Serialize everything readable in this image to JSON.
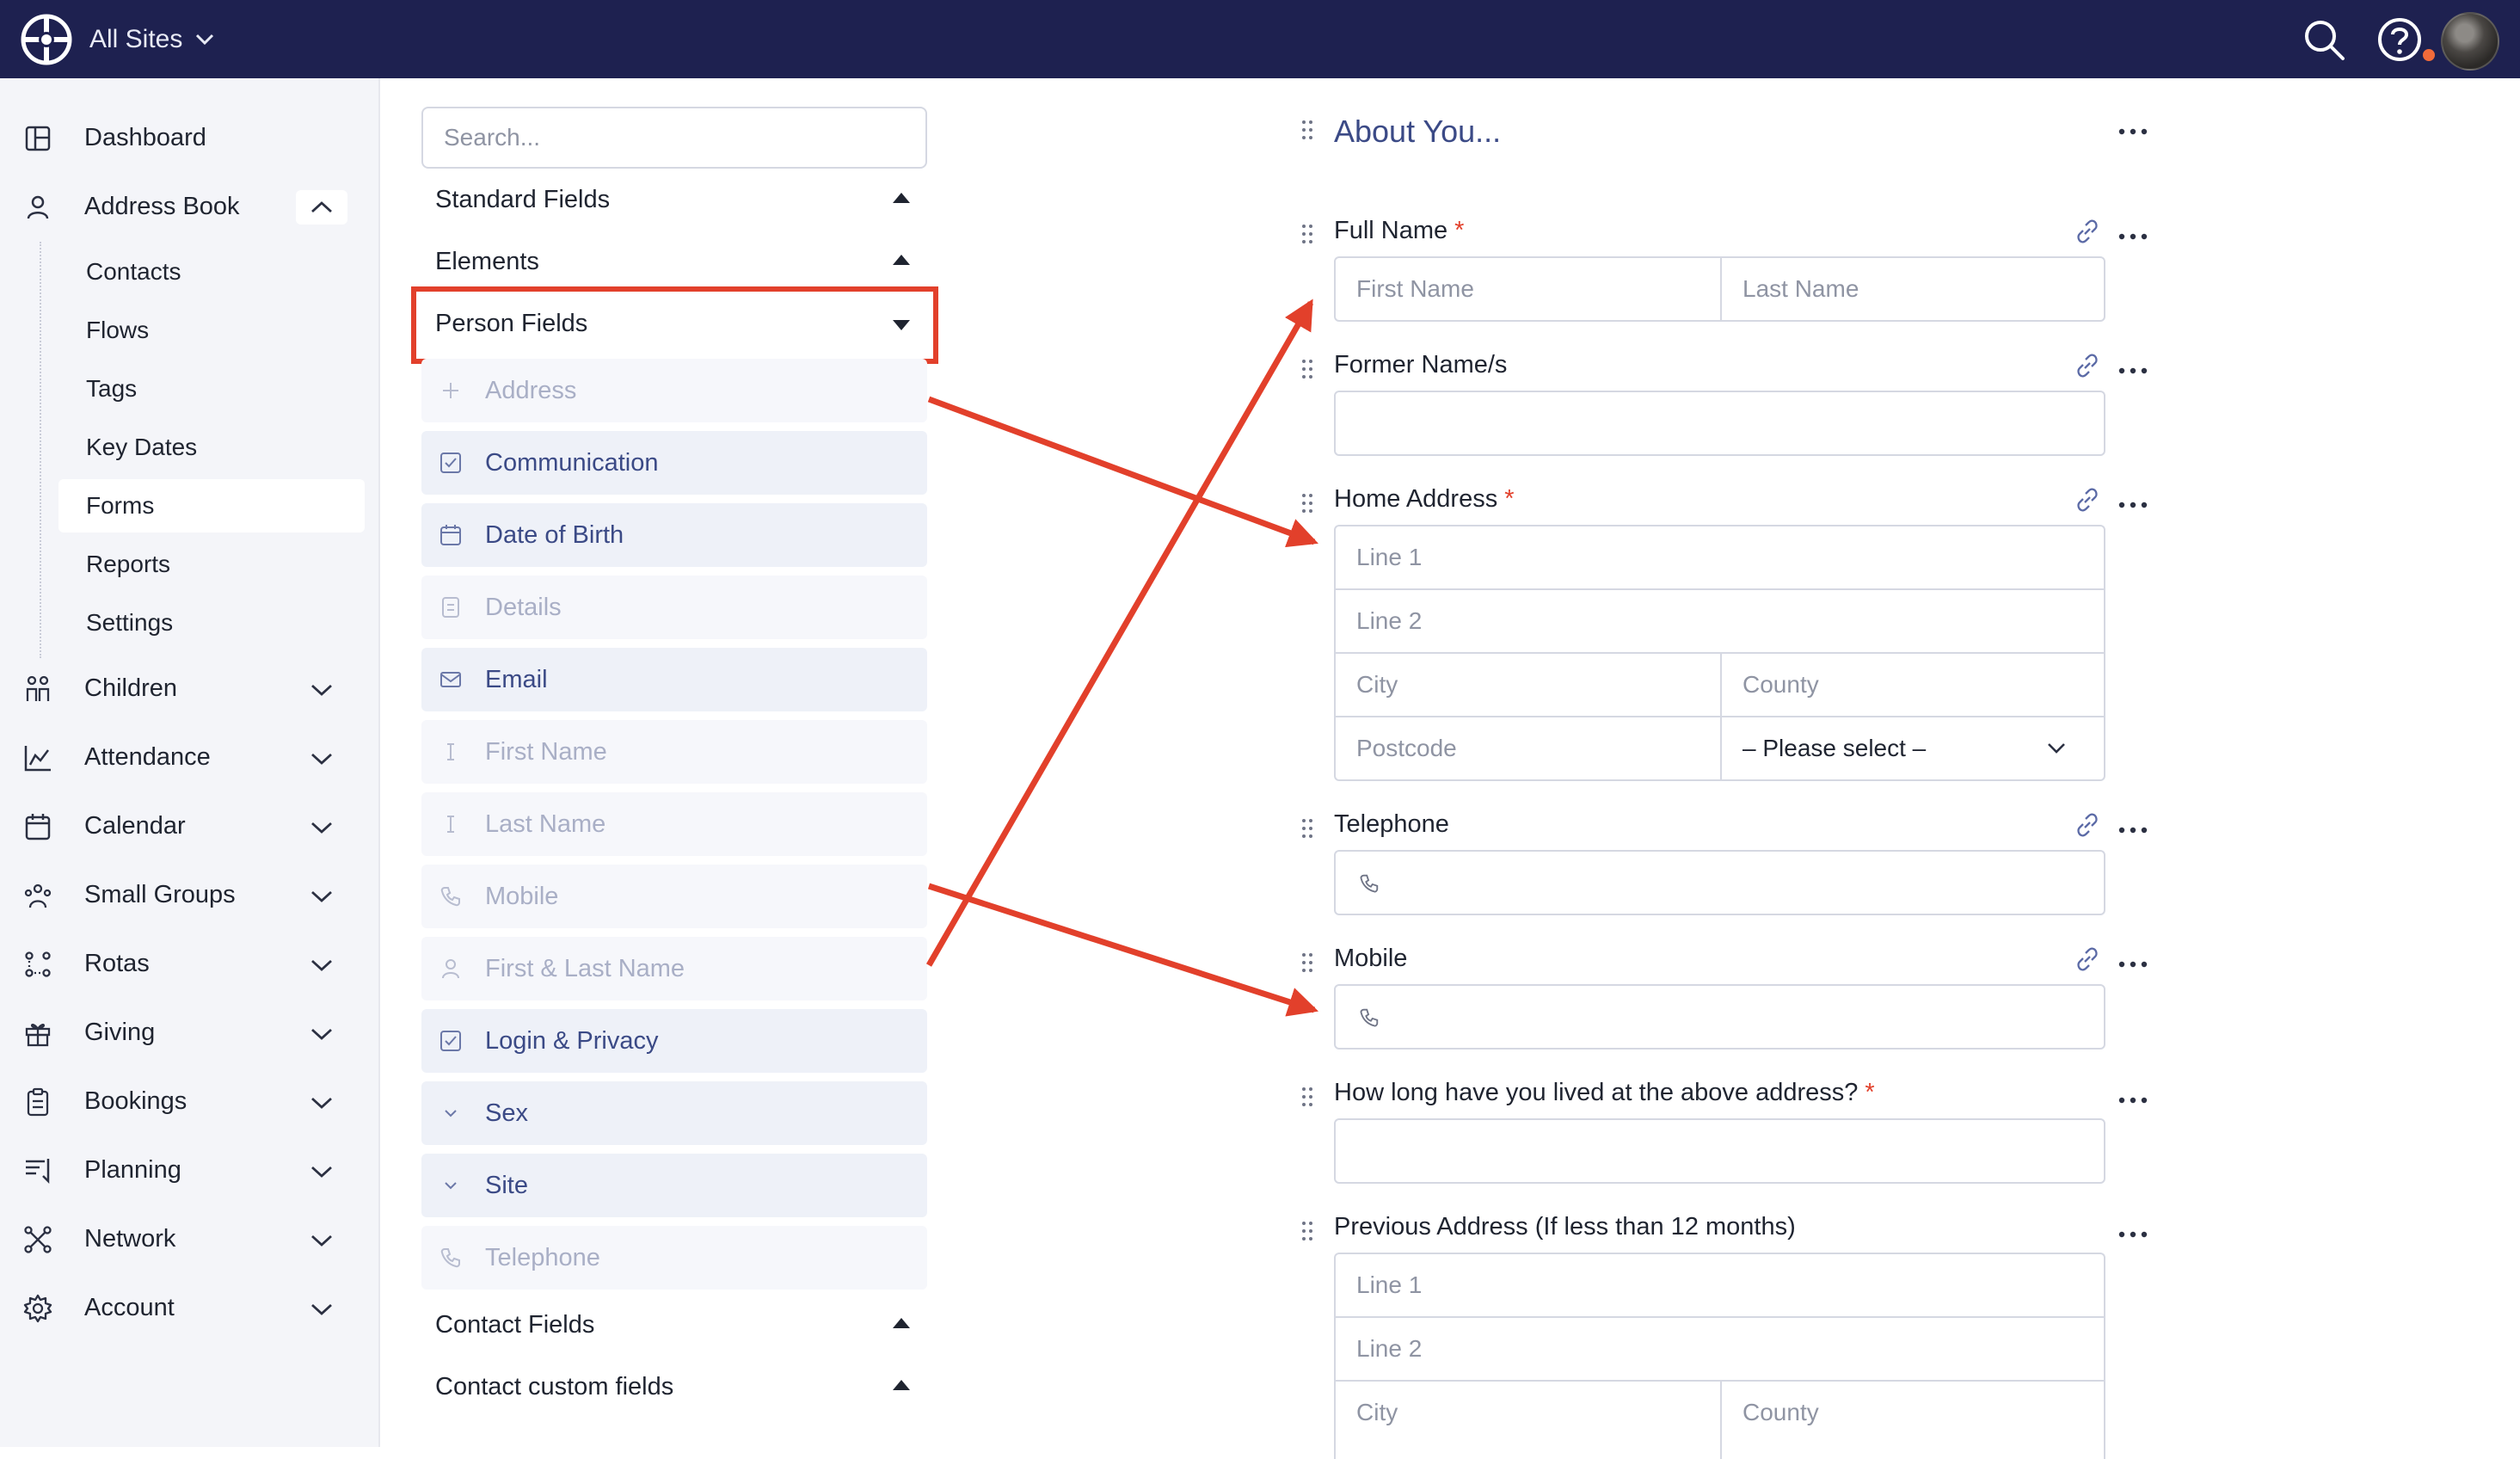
{
  "topbar": {
    "site_label": "All Sites",
    "icons": [
      "globe-logo-icon",
      "search-icon",
      "help-icon",
      "user-avatar"
    ]
  },
  "sidebar": {
    "items": [
      {
        "label": "Dashboard",
        "icon": "dashboard-icon"
      },
      {
        "label": "Address Book",
        "icon": "person-icon",
        "expanded": true
      },
      {
        "label": "Children",
        "icon": "children-icon"
      },
      {
        "label": "Attendance",
        "icon": "attendance-chart-icon"
      },
      {
        "label": "Calendar",
        "icon": "calendar-icon"
      },
      {
        "label": "Small Groups",
        "icon": "small-groups-icon"
      },
      {
        "label": "Rotas",
        "icon": "rotas-icon"
      },
      {
        "label": "Giving",
        "icon": "gift-icon"
      },
      {
        "label": "Bookings",
        "icon": "clipboard-icon"
      },
      {
        "label": "Planning",
        "icon": "planning-icon"
      },
      {
        "label": "Network",
        "icon": "network-icon"
      },
      {
        "label": "Account",
        "icon": "gear-icon"
      }
    ],
    "address_book_subitems": [
      "Contacts",
      "Flows",
      "Tags",
      "Key Dates",
      "Forms",
      "Reports",
      "Settings"
    ],
    "active_subitem": "Forms"
  },
  "picker": {
    "search_placeholder": "Search...",
    "sections": {
      "standard": "Standard Fields",
      "elements": "Elements",
      "person": "Person Fields",
      "contact": "Contact Fields",
      "contact_custom": "Contact custom fields"
    },
    "person_fields": [
      {
        "label": "Address",
        "icon": "plus-icon",
        "disabled": true
      },
      {
        "label": "Communication",
        "icon": "checkbox-icon",
        "disabled": false
      },
      {
        "label": "Date of Birth",
        "icon": "calendar-icon",
        "disabled": false
      },
      {
        "label": "Details",
        "icon": "details-icon",
        "disabled": true
      },
      {
        "label": "Email",
        "icon": "email-icon",
        "disabled": false
      },
      {
        "label": "First Name",
        "icon": "text-cursor-icon",
        "disabled": true
      },
      {
        "label": "Last Name",
        "icon": "text-cursor-icon",
        "disabled": true
      },
      {
        "label": "Mobile",
        "icon": "phone-icon",
        "disabled": true
      },
      {
        "label": "First & Last Name",
        "icon": "person-icon",
        "disabled": true
      },
      {
        "label": "Login & Privacy",
        "icon": "checkbox-icon",
        "disabled": false
      },
      {
        "label": "Sex",
        "icon": "dropdown-icon",
        "disabled": false
      },
      {
        "label": "Site",
        "icon": "dropdown-icon",
        "disabled": false
      },
      {
        "label": "Telephone",
        "icon": "phone-icon",
        "disabled": true
      }
    ]
  },
  "form": {
    "title": "About You...",
    "required_mark": "*",
    "full_name": {
      "label": "Full Name",
      "first_placeholder": "First Name",
      "last_placeholder": "Last Name"
    },
    "former_name": {
      "label": "Former Name/s"
    },
    "home_address": {
      "label": "Home Address",
      "line1": "Line 1",
      "line2": "Line 2",
      "city": "City",
      "county": "County",
      "postcode": "Postcode",
      "country_select": "– Please select –"
    },
    "telephone": {
      "label": "Telephone"
    },
    "mobile": {
      "label": "Mobile"
    },
    "how_long": {
      "label": "How long have you lived at the above address?"
    },
    "previous_address": {
      "label": "Previous Address (If less than 12 months)",
      "line1": "Line 1",
      "line2": "Line 2",
      "city": "City",
      "county": "County"
    }
  },
  "annotation_color": "#e2402b"
}
